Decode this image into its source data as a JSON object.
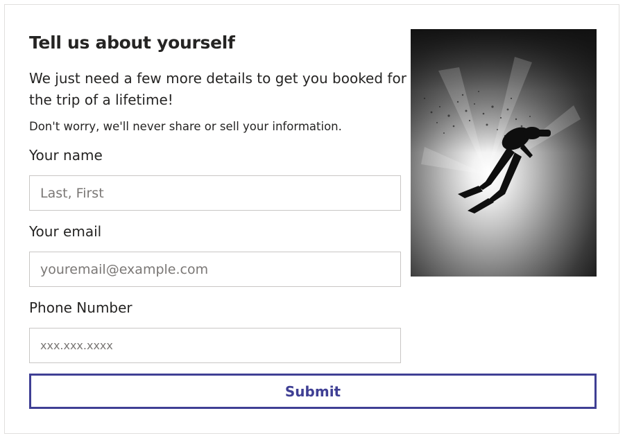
{
  "form": {
    "title": "Tell us about yourself",
    "intro": "We just need a few more details to get you booked for the trip of a lifetime!",
    "privacy_note": "Don't worry, we'll never share or sell your information.",
    "fields": {
      "name": {
        "label": "Your name",
        "placeholder": "Last, First",
        "value": ""
      },
      "email": {
        "label": "Your email",
        "placeholder": "youremail@example.com",
        "value": ""
      },
      "phone": {
        "label": "Phone Number",
        "placeholder": "xxx.xxx.xxxx",
        "value": ""
      }
    },
    "submit_label": "Submit"
  },
  "image": {
    "subject": "scuba-diver-silhouette-underwater-photo"
  },
  "colors": {
    "accent": "#3f3f94",
    "text": "#252423",
    "field_border": "#c8c6c4",
    "placeholder": "#7a7775"
  }
}
